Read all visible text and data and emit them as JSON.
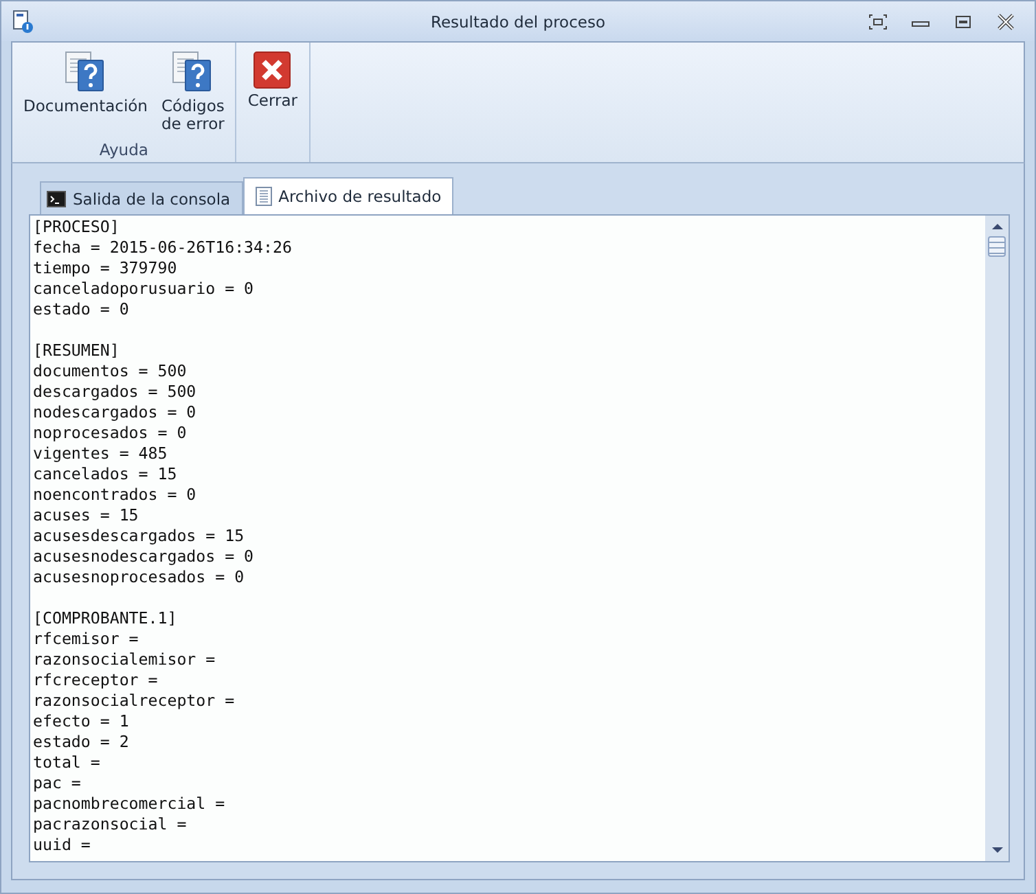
{
  "window": {
    "title": "Resultado del proceso"
  },
  "ribbon": {
    "groups": [
      {
        "label": "Ayuda",
        "buttons": [
          {
            "label": "Documentación",
            "kind": "help"
          },
          {
            "label": "Códigos\nde error",
            "kind": "help"
          }
        ]
      },
      {
        "buttons": [
          {
            "label": "Cerrar",
            "kind": "close"
          }
        ]
      }
    ]
  },
  "tabs": [
    {
      "label": "Salida de la consola",
      "kind": "console",
      "selected": false
    },
    {
      "label": "Archivo de resultado",
      "kind": "document",
      "selected": true
    }
  ],
  "sections": [
    {
      "lines": [
        "[PROCESO]",
        "fecha = 2015-06-26T16:34:26",
        "tiempo = 379790",
        "canceladoporusuario = 0",
        "estado = 0"
      ]
    },
    {
      "lines": [
        "[RESUMEN]",
        "documentos = 500",
        "descargados = 500",
        "nodescargados = 0",
        "noprocesados = 0",
        "vigentes = 485",
        "cancelados = 15",
        "noencontrados = 0",
        "acuses = 15",
        "acusesdescargados = 15",
        "acusesnodescargados = 0",
        "acusesnoprocesados = 0"
      ]
    },
    {
      "lines": [
        "[COMPROBANTE.1]",
        "rfcemisor =",
        "razonsocialemisor =",
        "rfcreceptor =",
        "razonsocialreceptor =",
        "efecto = 1",
        "estado = 2",
        "total =",
        "pac =",
        "pacnombrecomercial =",
        "pacrazonsocial =",
        "uuid ="
      ]
    }
  ]
}
